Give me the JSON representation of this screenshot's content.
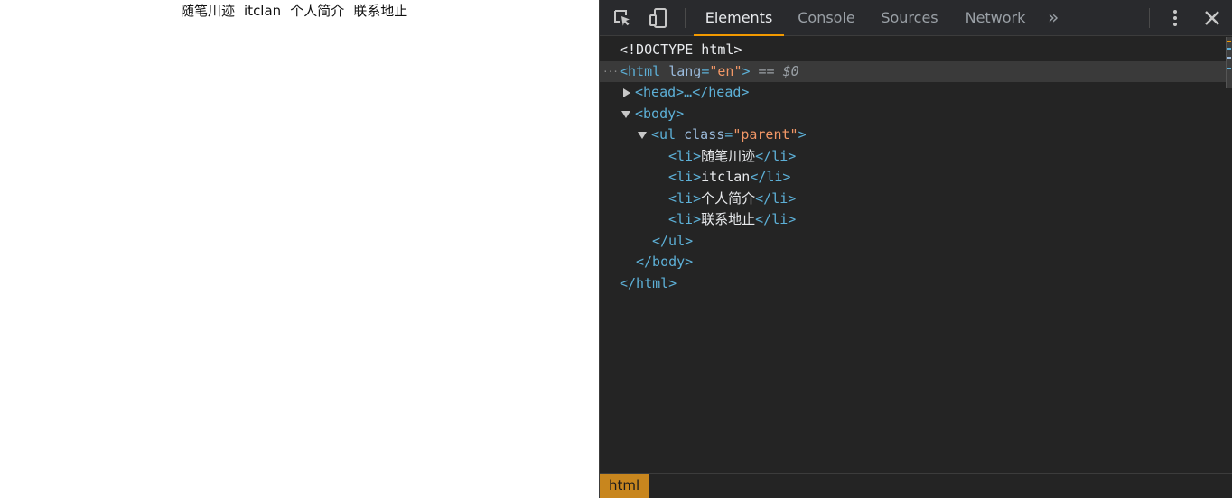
{
  "page": {
    "nav_items": [
      "随笔川迹",
      "itclan",
      "个人简介",
      "联系地止"
    ]
  },
  "devtools": {
    "tabs": [
      "Elements",
      "Console",
      "Sources",
      "Network"
    ],
    "active_tab": "Elements",
    "more_tabs_glyph": "»",
    "icons": [
      "inspect-element-icon",
      "device-toolbar-icon",
      "more-options-icon",
      "close-icon"
    ],
    "colors": {
      "accent": "#f29900",
      "tag": "#5db0d7",
      "attr_name": "#9bbbdc",
      "attr_value": "#f29766",
      "background": "#242424",
      "breadcrumb": "#c8861e"
    },
    "tree": {
      "doctype": "<!DOCTYPE html>",
      "html_open_tag": "<html",
      "html_lang_attr": "lang",
      "html_lang_value": "en",
      "html_close_bracket": ">",
      "selected_marker": "== $0",
      "head": "<head>…</head>",
      "body_open": "<body>",
      "ul_open_tag": "<ul",
      "ul_class_attr": "class",
      "ul_class_value": "parent",
      "ul_close_bracket": ">",
      "li_open": "<li>",
      "li_close": "</li>",
      "li_items": [
        "随笔川迹",
        "itclan",
        "个人简介",
        "联系地止"
      ],
      "ul_close": "</ul>",
      "body_close": "</body>",
      "html_close": "</html>"
    },
    "breadcrumb": "html"
  }
}
